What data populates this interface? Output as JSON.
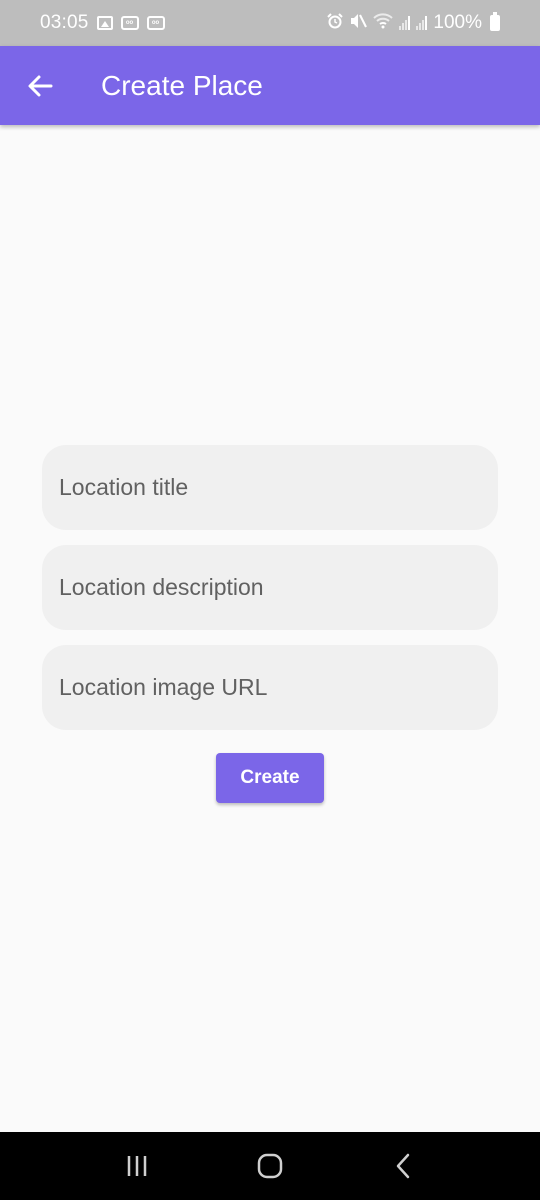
{
  "status_bar": {
    "time": "03:05",
    "battery": "100%",
    "icons": [
      "gallery-icon",
      "voicemail-icon",
      "voicemail-icon",
      "alarm-icon",
      "mute-icon",
      "wifi-icon",
      "signal-icon",
      "signal-icon",
      "battery-icon"
    ]
  },
  "app_bar": {
    "title": "Create Place",
    "back_icon": "arrow-left-icon",
    "color": "#7b66e8"
  },
  "form": {
    "fields": [
      {
        "placeholder": "Location title",
        "value": ""
      },
      {
        "placeholder": "Location description",
        "value": ""
      },
      {
        "placeholder": "Location image URL",
        "value": ""
      }
    ],
    "submit_label": "Create"
  },
  "nav_bar": {
    "icons": [
      "recents-icon",
      "home-icon",
      "back-icon"
    ]
  }
}
